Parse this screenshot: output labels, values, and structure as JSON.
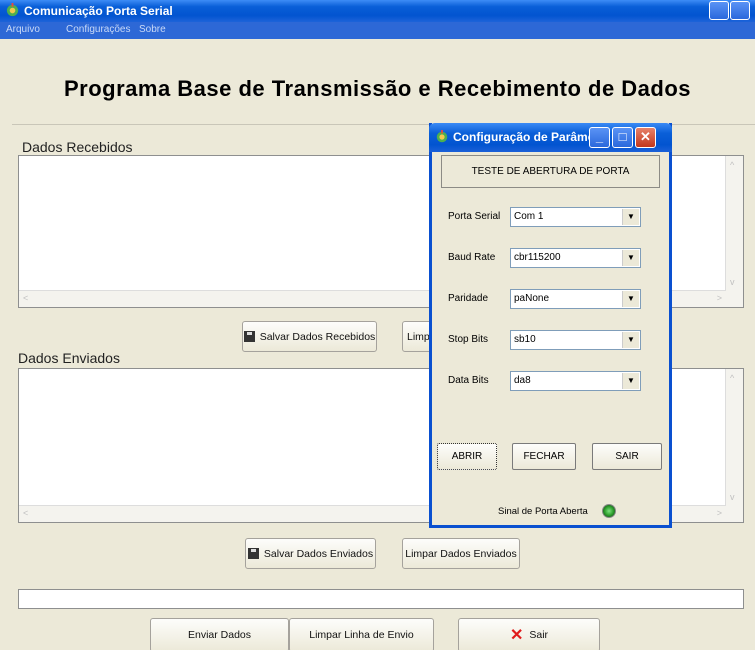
{
  "window": {
    "title": "Comunicação Porta Serial"
  },
  "menu": [
    "Arquivo",
    "Configurações",
    "Sobre"
  ],
  "heading": "Programa Base de Transmissão e Recebimento de Dados",
  "received": {
    "label": "Dados Recebidos",
    "save_button": "Salvar Dados Recebidos",
    "clear_button": "Limpar Dados Recebidos"
  },
  "sent": {
    "label": "Dados Enviados",
    "save_button": "Salvar Dados Enviados",
    "clear_button": "Limpar Dados Enviados"
  },
  "bottom": {
    "send_button": "Enviar Dados",
    "clear_line_button": "Limpar Linha de Envio",
    "exit_button": "Sair"
  },
  "dialog": {
    "title": "Configuração de Parâme...",
    "test_label": "TESTE DE ABERTURA DE PORTA",
    "fields": [
      {
        "label": "Porta Serial",
        "value": "Com 1"
      },
      {
        "label": "Baud Rate",
        "value": "cbr115200"
      },
      {
        "label": "Paridade",
        "value": "paNone"
      },
      {
        "label": "Stop Bits",
        "value": "sb10"
      },
      {
        "label": "Data Bits",
        "value": "da8"
      }
    ],
    "buttons": {
      "open": "ABRIR",
      "close": "FECHAR",
      "exit": "SAIR"
    },
    "signal_label": "Sinal de Porta Aberta"
  },
  "icons": {
    "app": "gear-app-icon",
    "save": "floppy-disk-icon",
    "exit": "red-x-icon",
    "signal": "green-led-icon"
  },
  "colors": {
    "titlebar": "#0a5fd8",
    "window_bg": "#ece9d8",
    "close_button": "#c2361c",
    "led": "#2ea02e"
  }
}
